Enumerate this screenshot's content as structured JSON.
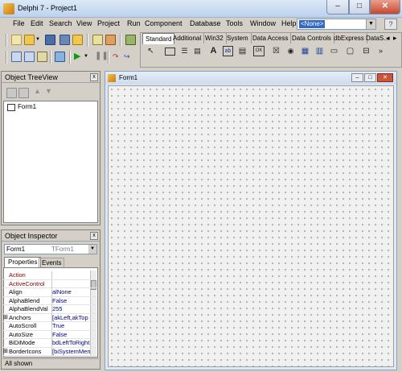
{
  "window": {
    "title": "Delphi 7 - Project1",
    "minimize": "–",
    "maximize": "□",
    "close": "✕"
  },
  "menu": [
    "File",
    "Edit",
    "Search",
    "View",
    "Project",
    "Run",
    "Component",
    "Database",
    "Tools",
    "Window",
    "Help"
  ],
  "desktop_combo": {
    "value": "<None>"
  },
  "palette": {
    "tabs": [
      "Standard",
      "Additional",
      "Win32",
      "System",
      "Data Access",
      "Data Controls",
      "dbExpress",
      "DataS..."
    ],
    "active_tab": "Standard",
    "components": [
      "pointer-icon",
      "frame-icon",
      "mainmenu-icon",
      "popupmenu-icon",
      "label-icon",
      "edit-icon",
      "memo-icon",
      "button-icon",
      "checkbox-icon",
      "radiobutton-icon",
      "listbox-icon",
      "combobox-icon",
      "scrollbar-icon",
      "groupbox-icon",
      "more-icon"
    ]
  },
  "object_treeview": {
    "title": "Object TreeView",
    "close": "x",
    "node": "Form1"
  },
  "object_inspector": {
    "title": "Object Inspector",
    "close": "x",
    "object_name": "Form1",
    "object_type": "TForm1",
    "tabs": [
      "Properties",
      "Events"
    ],
    "rows": [
      {
        "name": "Action",
        "value": "",
        "color": "#800000"
      },
      {
        "name": "ActiveControl",
        "value": "",
        "color": "#800000"
      },
      {
        "name": "Align",
        "value": "alNone",
        "color": "#000000"
      },
      {
        "name": "AlphaBlend",
        "value": "False",
        "color": "#000000"
      },
      {
        "name": "AlphaBlendVal",
        "value": "255",
        "color": "#000000"
      },
      {
        "name": "Anchors",
        "value": "[akLeft,akTop",
        "color": "#000000",
        "expand": "⊞"
      },
      {
        "name": "AutoScroll",
        "value": "True",
        "color": "#000000"
      },
      {
        "name": "AutoSize",
        "value": "False",
        "color": "#000000"
      },
      {
        "name": "BiDiMode",
        "value": "bdLeftToRight",
        "color": "#000000"
      },
      {
        "name": "BorderIcons",
        "value": "[biSystemMen",
        "color": "#000000",
        "expand": "⊞"
      }
    ],
    "status": "All shown"
  },
  "form": {
    "title": "Form1",
    "minimize": "–",
    "maximize": "□",
    "close": "✕"
  }
}
